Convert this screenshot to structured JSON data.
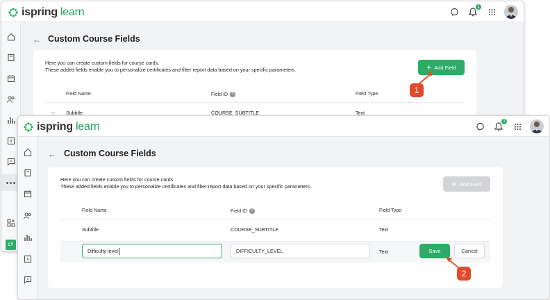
{
  "app": {
    "logo_part1": "ispring",
    "logo_part2": "learn",
    "notification_count": "1",
    "user_initials": "LT"
  },
  "page": {
    "title": "Custom Course Fields",
    "desc_line1": "Here you can create custom fields for course cards.",
    "desc_line2": "These added fields enable you to personalize certificates and filter report data based on your specific parameters.",
    "add_field_label": "Add Field"
  },
  "table": {
    "headers": {
      "field_name": "Field Name",
      "field_id": "Field ID",
      "field_type": "Field Type"
    },
    "rows": [
      {
        "name": "Subtitle",
        "id": "COURSE_SUBTITLE",
        "type": "Text"
      }
    ]
  },
  "edit_row": {
    "name_value": "Difficulty level",
    "id_value": "DIFFICULTY_LEVEL",
    "type": "Text",
    "save_label": "Save",
    "cancel_label": "Cancel"
  },
  "steps": [
    "1",
    "2"
  ],
  "colors": {
    "accent": "#2eac67",
    "step": "#e24a2c",
    "disabled": "#d2d4d8"
  }
}
